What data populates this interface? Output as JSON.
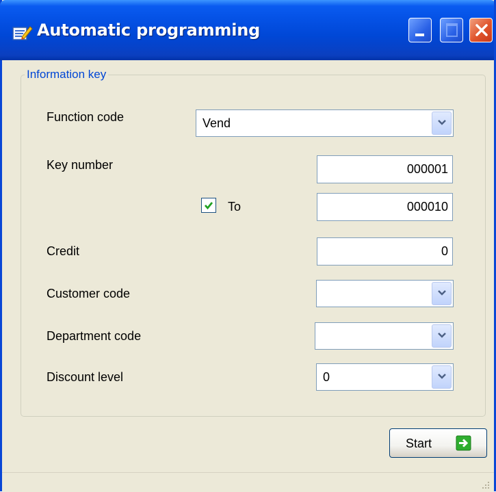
{
  "window": {
    "title": "Automatic programming",
    "icon": "app-edit-icon"
  },
  "titlebar_buttons": [
    "minimize-icon",
    "maximize-icon",
    "close-icon"
  ],
  "group": {
    "title": "Information key",
    "function_code": {
      "label": "Function code",
      "value": "Vend"
    },
    "key_number": {
      "label": "Key number",
      "value": "000001"
    },
    "to": {
      "label": "To",
      "checked": true,
      "value": "000010"
    },
    "credit": {
      "label": "Credit",
      "value": "0"
    },
    "customer_code": {
      "label": "Customer code",
      "value": ""
    },
    "department_code": {
      "label": "Department code",
      "value": ""
    },
    "discount_level": {
      "label": "Discount level",
      "value": "0"
    }
  },
  "buttons": {
    "start_label": "Start",
    "start_icon": "green-arrow-icon"
  },
  "colors": {
    "title_blue": "#0054e3",
    "group_title": "#0046d5",
    "close_red": "#e0542c",
    "face": "#ece9d8"
  }
}
